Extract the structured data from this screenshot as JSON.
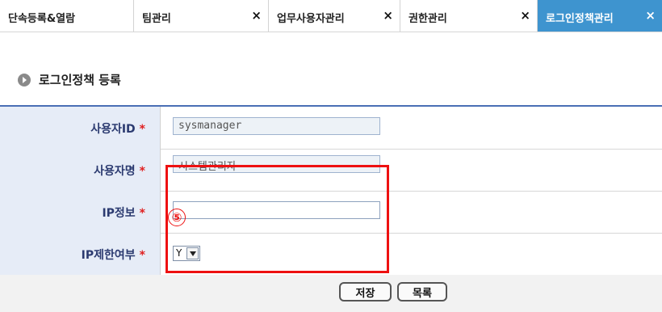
{
  "tabs": [
    {
      "label": "단속등록&열람",
      "closable": false,
      "active": false
    },
    {
      "label": "팀관리",
      "close": "×",
      "active": false
    },
    {
      "label": "업무사용자관리",
      "close": "×",
      "active": false
    },
    {
      "label": "권한관리",
      "close": "×",
      "active": false
    },
    {
      "label": "로그인정책관리",
      "close": "×",
      "active": true
    }
  ],
  "section": {
    "title": "로그인정책 등록",
    "bullet_icon": "arrow-circle-icon"
  },
  "form": {
    "required_mark": "*",
    "rows": [
      {
        "label": "사용자ID",
        "value": "sysmanager",
        "readonly": true
      },
      {
        "label": "사용자명",
        "value": "시스템관리자",
        "readonly": true
      },
      {
        "label": "IP정보",
        "value": "",
        "readonly": false
      },
      {
        "label": "IP제한여부",
        "selected": "Y"
      }
    ]
  },
  "buttons": {
    "save": "저장",
    "list": "목록"
  },
  "annotation": {
    "marker": "⑤",
    "color": "#ee1111"
  },
  "colors": {
    "active_tab": "#3e94cf",
    "label_bg": "#e6ecf7",
    "label_text": "#2b3a70",
    "required": "#e02020"
  }
}
